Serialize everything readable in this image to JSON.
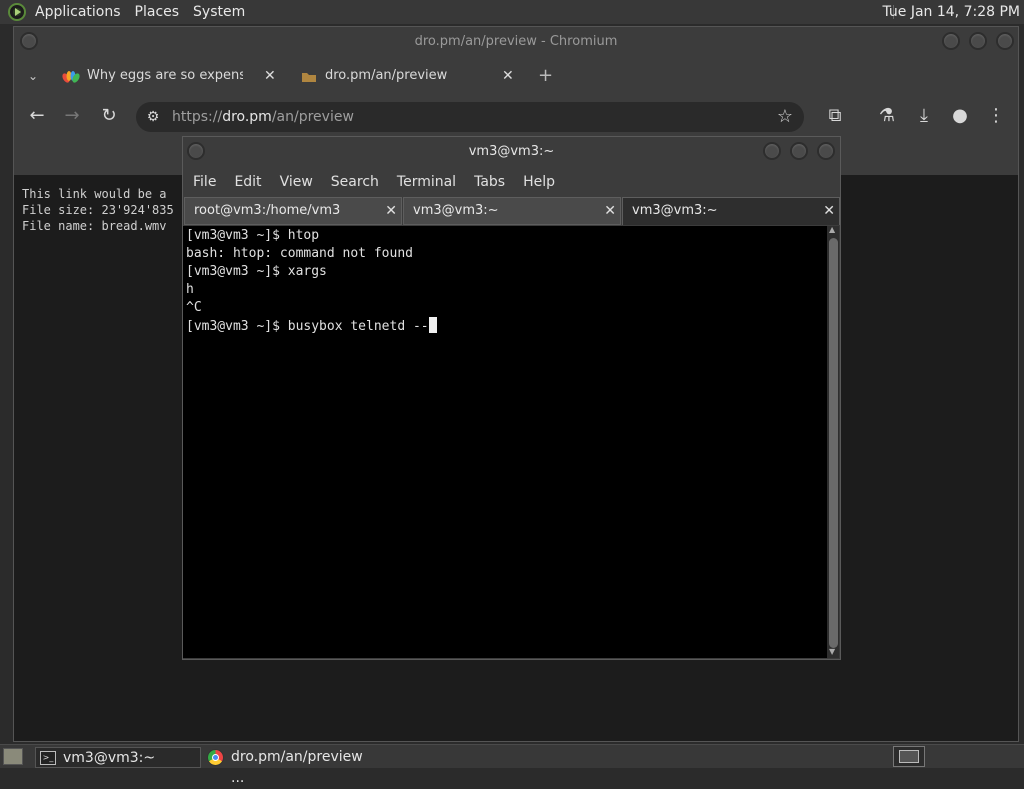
{
  "top_panel": {
    "menus": [
      "Applications",
      "Places",
      "System"
    ],
    "clock": "Tue Jan 14,  7:28 PM"
  },
  "chromium": {
    "title": "dro.pm/an/preview - Chromium",
    "tabs": [
      {
        "label": "Why eggs are so expensive r",
        "icon": "nbc-peacock-icon"
      },
      {
        "label": "dro.pm/an/preview",
        "icon": "folder-icon"
      }
    ],
    "new_tab": "+",
    "url_scheme": "https://",
    "url_host": "dro.pm",
    "url_path": "/an/preview",
    "page_lines": [
      "This link would be a",
      "File size: 23'924'835",
      "File name: bread.wmv"
    ]
  },
  "terminal": {
    "title": "vm3@vm3:~",
    "menu": [
      "File",
      "Edit",
      "View",
      "Search",
      "Terminal",
      "Tabs",
      "Help"
    ],
    "tabs": [
      {
        "label": "root@vm3:/home/vm3",
        "active": false
      },
      {
        "label": "vm3@vm3:~",
        "active": false
      },
      {
        "label": "vm3@vm3:~",
        "active": true
      }
    ],
    "lines": [
      "[vm3@vm3 ~]$ htop",
      "bash: htop: command not found",
      "[vm3@vm3 ~]$ xargs",
      "h",
      "^C",
      "[vm3@vm3 ~]$ busybox telnetd --"
    ]
  },
  "taskbar": {
    "items": [
      {
        "label": "vm3@vm3:~",
        "icon": "terminal-icon"
      },
      {
        "label": "dro.pm/an/preview ...",
        "icon": "chromium-icon"
      }
    ]
  }
}
